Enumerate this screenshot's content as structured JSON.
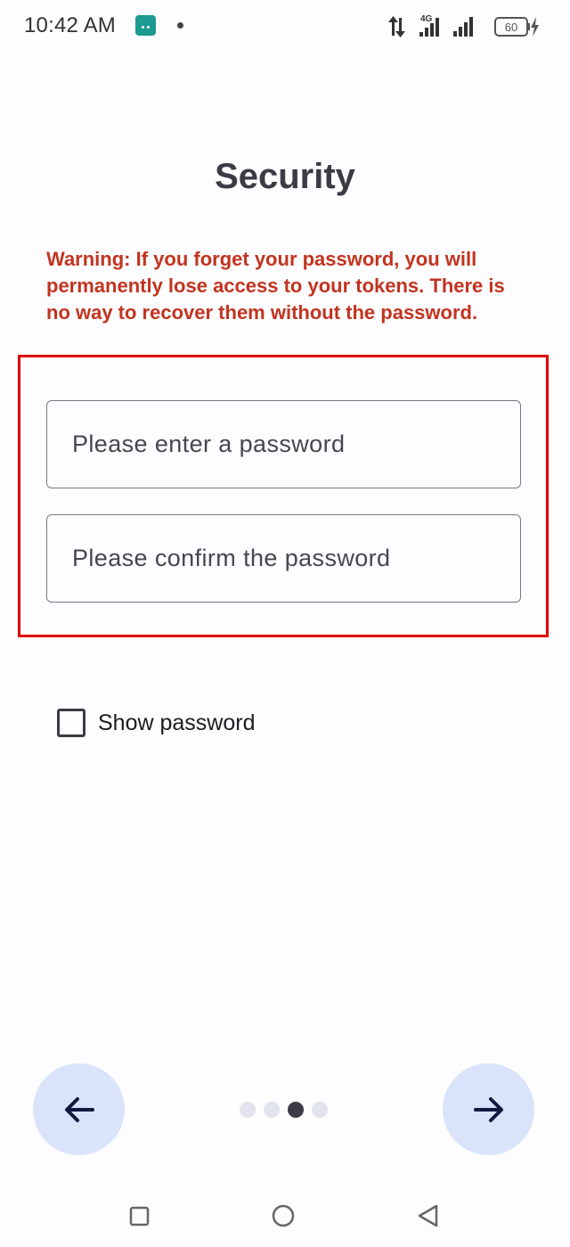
{
  "status_bar": {
    "time": "10:42 AM",
    "network_type": "4G",
    "battery_level": "60"
  },
  "page": {
    "title": "Security",
    "warning": "Warning: If you forget your password, you will permanently lose access to your tokens. There is no way to recover them without the password."
  },
  "form": {
    "password_placeholder": "Please enter a password",
    "password_value": "",
    "confirm_placeholder": "Please confirm the password",
    "confirm_value": "",
    "show_password_label": "Show password",
    "show_password_checked": false
  },
  "pager": {
    "total_pages": 4,
    "current_page": 3
  },
  "icons": {
    "back": "arrow-left-icon",
    "next": "arrow-right-icon",
    "recents": "square-icon",
    "home": "circle-icon",
    "system_back": "triangle-left-icon"
  },
  "colors": {
    "warning": "#c2341f",
    "highlight": "#e00000",
    "nav_button": "#d9e4fb",
    "pager_active": "#3a3b45",
    "pager_inactive": "#e2e3ee"
  }
}
